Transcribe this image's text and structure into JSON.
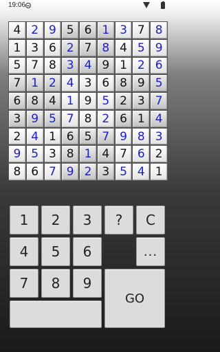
{
  "status": {
    "time": "19:06"
  },
  "board": {
    "rows": [
      [
        {
          "v": "4",
          "t": "given"
        },
        {
          "v": "2",
          "t": "entered"
        },
        {
          "v": "9",
          "t": "entered"
        },
        {
          "v": "5",
          "t": "given"
        },
        {
          "v": "6",
          "t": "given"
        },
        {
          "v": "1",
          "t": "entered"
        },
        {
          "v": "3",
          "t": "entered"
        },
        {
          "v": "7",
          "t": "given"
        },
        {
          "v": "8",
          "t": "entered"
        }
      ],
      [
        {
          "v": "1",
          "t": "given"
        },
        {
          "v": "3",
          "t": "given"
        },
        {
          "v": "6",
          "t": "given"
        },
        {
          "v": "2",
          "t": "entered"
        },
        {
          "v": "7",
          "t": "given"
        },
        {
          "v": "8",
          "t": "entered"
        },
        {
          "v": "4",
          "t": "given"
        },
        {
          "v": "5",
          "t": "entered"
        },
        {
          "v": "9",
          "t": "entered"
        }
      ],
      [
        {
          "v": "5",
          "t": "given"
        },
        {
          "v": "7",
          "t": "given"
        },
        {
          "v": "8",
          "t": "given"
        },
        {
          "v": "3",
          "t": "entered"
        },
        {
          "v": "4",
          "t": "entered"
        },
        {
          "v": "9",
          "t": "given"
        },
        {
          "v": "1",
          "t": "given"
        },
        {
          "v": "2",
          "t": "entered"
        },
        {
          "v": "6",
          "t": "entered"
        }
      ],
      [
        {
          "v": "7",
          "t": "given"
        },
        {
          "v": "1",
          "t": "entered"
        },
        {
          "v": "2",
          "t": "entered"
        },
        {
          "v": "4",
          "t": "entered"
        },
        {
          "v": "3",
          "t": "given"
        },
        {
          "v": "6",
          "t": "given"
        },
        {
          "v": "8",
          "t": "given"
        },
        {
          "v": "9",
          "t": "given"
        },
        {
          "v": "5",
          "t": "entered"
        }
      ],
      [
        {
          "v": "6",
          "t": "given"
        },
        {
          "v": "8",
          "t": "given"
        },
        {
          "v": "4",
          "t": "given"
        },
        {
          "v": "1",
          "t": "entered"
        },
        {
          "v": "9",
          "t": "given"
        },
        {
          "v": "5",
          "t": "entered"
        },
        {
          "v": "2",
          "t": "given"
        },
        {
          "v": "3",
          "t": "given"
        },
        {
          "v": "7",
          "t": "entered"
        }
      ],
      [
        {
          "v": "3",
          "t": "given"
        },
        {
          "v": "9",
          "t": "entered"
        },
        {
          "v": "5",
          "t": "entered"
        },
        {
          "v": "7",
          "t": "entered"
        },
        {
          "v": "8",
          "t": "given"
        },
        {
          "v": "2",
          "t": "entered"
        },
        {
          "v": "6",
          "t": "given"
        },
        {
          "v": "1",
          "t": "given"
        },
        {
          "v": "4",
          "t": "entered"
        }
      ],
      [
        {
          "v": "2",
          "t": "given"
        },
        {
          "v": "4",
          "t": "entered"
        },
        {
          "v": "1",
          "t": "given"
        },
        {
          "v": "6",
          "t": "given"
        },
        {
          "v": "5",
          "t": "given"
        },
        {
          "v": "7",
          "t": "entered"
        },
        {
          "v": "9",
          "t": "entered"
        },
        {
          "v": "8",
          "t": "entered"
        },
        {
          "v": "3",
          "t": "entered"
        }
      ],
      [
        {
          "v": "9",
          "t": "entered"
        },
        {
          "v": "5",
          "t": "entered"
        },
        {
          "v": "3",
          "t": "given"
        },
        {
          "v": "8",
          "t": "given"
        },
        {
          "v": "1",
          "t": "entered"
        },
        {
          "v": "4",
          "t": "given"
        },
        {
          "v": "7",
          "t": "given"
        },
        {
          "v": "6",
          "t": "entered"
        },
        {
          "v": "2",
          "t": "given"
        }
      ],
      [
        {
          "v": "8",
          "t": "given"
        },
        {
          "v": "6",
          "t": "given"
        },
        {
          "v": "7",
          "t": "entered"
        },
        {
          "v": "9",
          "t": "entered"
        },
        {
          "v": "2",
          "t": "entered"
        },
        {
          "v": "3",
          "t": "given"
        },
        {
          "v": "5",
          "t": "entered"
        },
        {
          "v": "4",
          "t": "entered"
        },
        {
          "v": "1",
          "t": "given"
        }
      ]
    ]
  },
  "keypad": {
    "k1": "1",
    "k2": "2",
    "k3": "3",
    "hint": "?",
    "clear": "C",
    "k4": "4",
    "k5": "5",
    "k6": "6",
    "more": "...",
    "k7": "7",
    "k8": "8",
    "k9": "9",
    "go": "GO",
    "blank": ""
  },
  "colors": {
    "given_digit": "#111111",
    "entered_digit": "#1c1ccc"
  }
}
